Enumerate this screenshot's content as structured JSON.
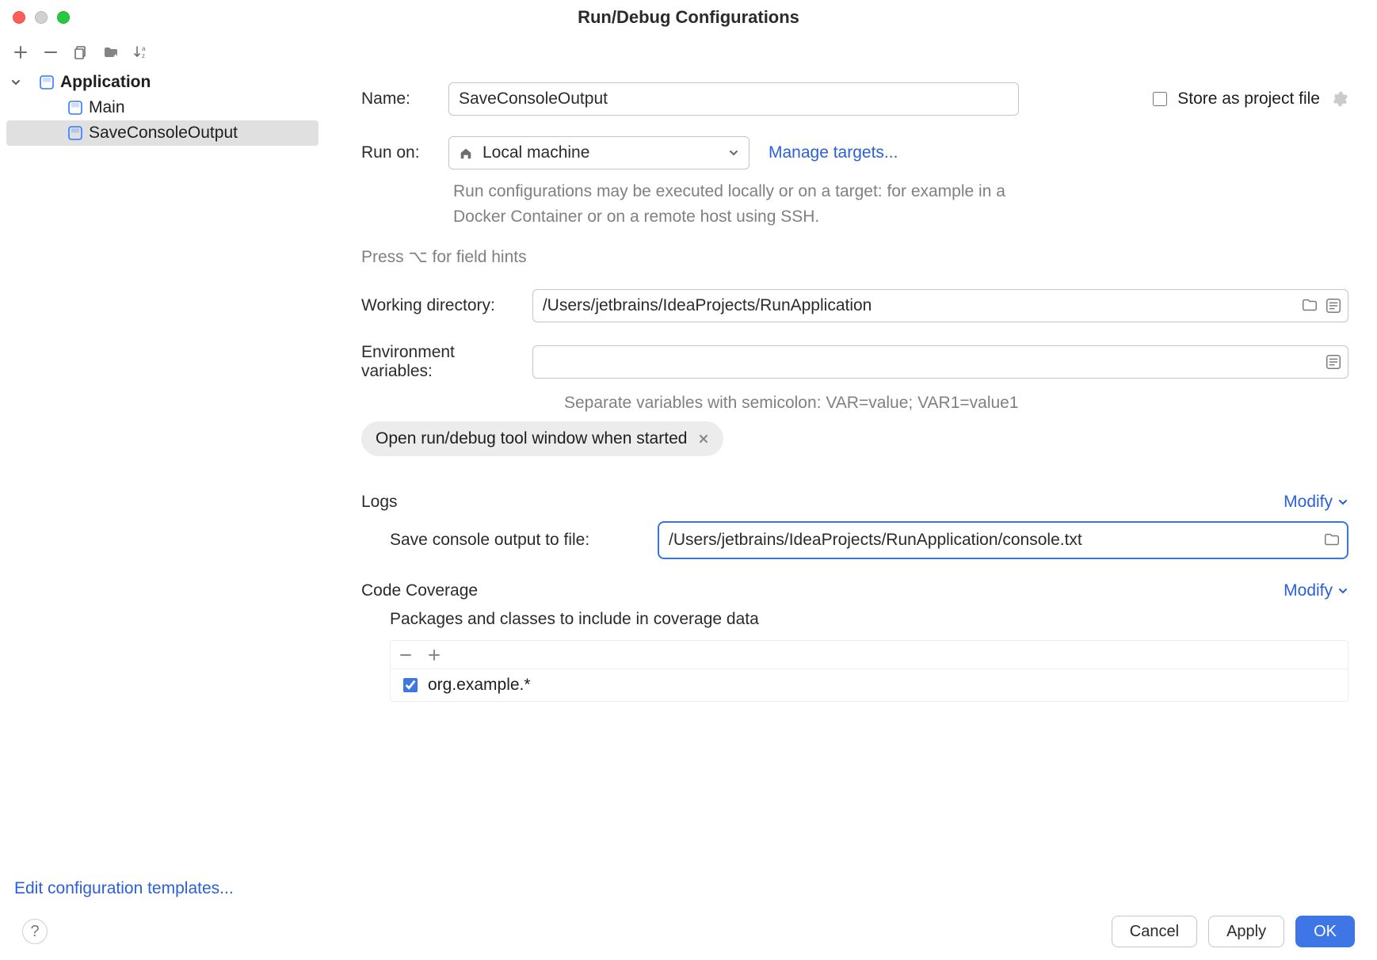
{
  "window": {
    "title": "Run/Debug Configurations"
  },
  "sidebar": {
    "group": "Application",
    "items": [
      "Main",
      "SaveConsoleOutput"
    ],
    "selected_index": 1,
    "footer_link": "Edit configuration templates..."
  },
  "form": {
    "name_label": "Name:",
    "name_value": "SaveConsoleOutput",
    "store_checkbox_label": "Store as project file",
    "runon_label": "Run on:",
    "runon_value": "Local machine",
    "manage_targets": "Manage targets...",
    "runon_hint": "Run configurations may be executed locally or on a target: for example in a Docker Container or on a remote host using SSH.",
    "press_hint": "Press ⌥ for field hints",
    "wd_label": "Working directory:",
    "wd_value": "/Users/jetbrains/IdeaProjects/RunApplication",
    "env_label": "Environment variables:",
    "env_hint": "Separate variables with semicolon: VAR=value; VAR1=value1",
    "chip": "Open run/debug tool window when started"
  },
  "logs": {
    "title": "Logs",
    "modify": "Modify",
    "save_label": "Save console output to file:",
    "save_value": "/Users/jetbrains/IdeaProjects/RunApplication/console.txt"
  },
  "coverage": {
    "title": "Code Coverage",
    "modify": "Modify",
    "subtitle": "Packages and classes to include in coverage data",
    "item_checked": true,
    "item_label": "org.example.*"
  },
  "footer": {
    "cancel": "Cancel",
    "apply": "Apply",
    "ok": "OK"
  }
}
